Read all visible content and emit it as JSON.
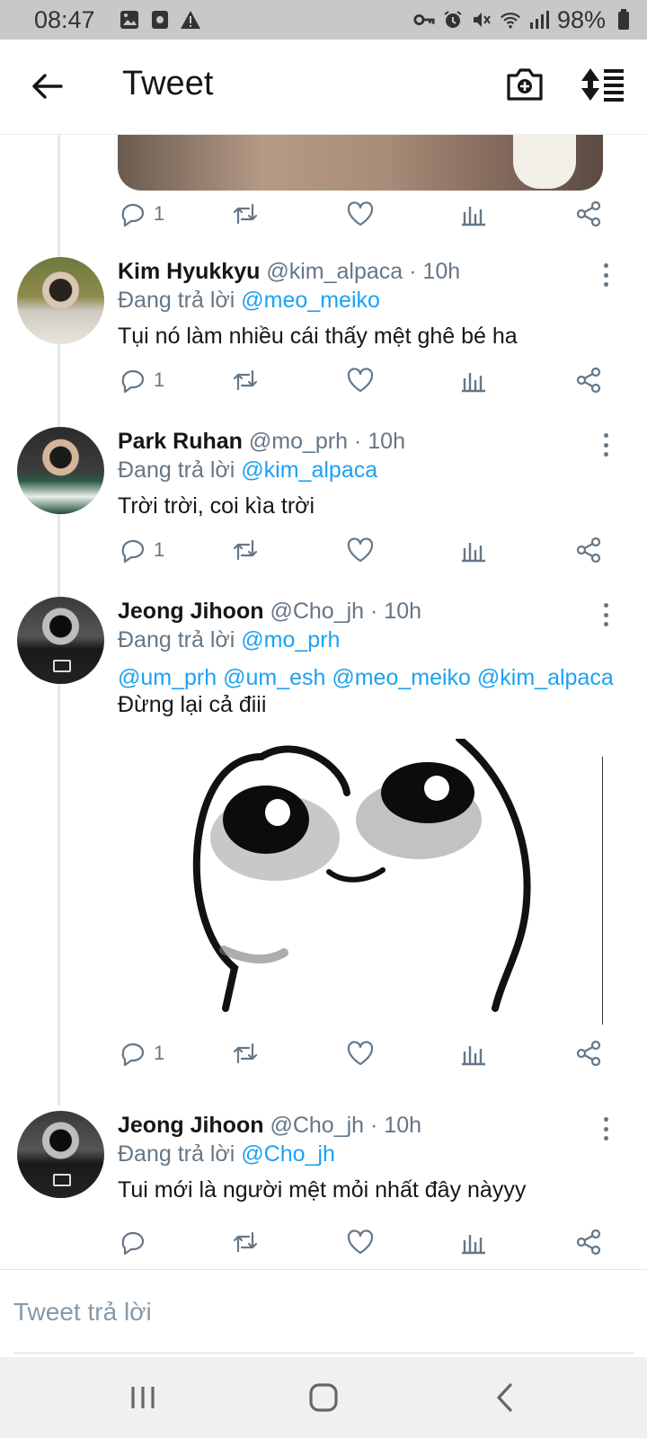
{
  "status_bar": {
    "time": "08:47",
    "battery": "98%",
    "icons_left": [
      "image-icon",
      "screen-record-icon",
      "warning-icon"
    ],
    "icons_right": [
      "vpn-key-icon",
      "alarm-icon",
      "mute-icon",
      "wifi-icon",
      "signal-icon",
      "battery-icon"
    ]
  },
  "header": {
    "title": "Tweet",
    "back_icon": "arrow-left-icon",
    "camera_icon": "camera-plus-icon",
    "sort_icon": "sort-icon"
  },
  "first_actions": {
    "reply_count": "1"
  },
  "tweets": [
    {
      "name": "Kim Hyukkyu",
      "handle": "@kim_alpaca",
      "time": "· 10h",
      "replying_label": "Đang trả lời",
      "replying_to": "@meo_meiko",
      "text": "Tụi nó làm nhiều cái thấy mệt ghê bé ha",
      "reply_count": "1"
    },
    {
      "name": "Park Ruhan",
      "handle": "@mo_prh",
      "time": "· 10h",
      "replying_label": "Đang trả lời",
      "replying_to": "@kim_alpaca",
      "text": "Trời trời, coi kìa trời",
      "reply_count": "1"
    },
    {
      "name": "Jeong Jihoon",
      "handle": "@Cho_jh",
      "time": "· 10h",
      "replying_label": "Đang trả lời",
      "replying_to": "@mo_prh",
      "mentions": "@um_prh @um_esh @meo_meiko @kim_alpaca",
      "text": "Đừng lại cả điii",
      "reply_count": "1"
    },
    {
      "name": "Jeong Jihoon",
      "handle": "@Cho_jh",
      "time": "· 10h",
      "replying_label": "Đang trả lời",
      "replying_to": "@Cho_jh",
      "text": "Tui mới là người mệt mỏi nhất đây nàyyy",
      "reply_count": ""
    }
  ],
  "composer": {
    "placeholder": "Tweet trả lời"
  },
  "navbar": {
    "recent_icon": "recent-apps-icon",
    "home_icon": "home-icon",
    "back_icon": "back-icon"
  }
}
